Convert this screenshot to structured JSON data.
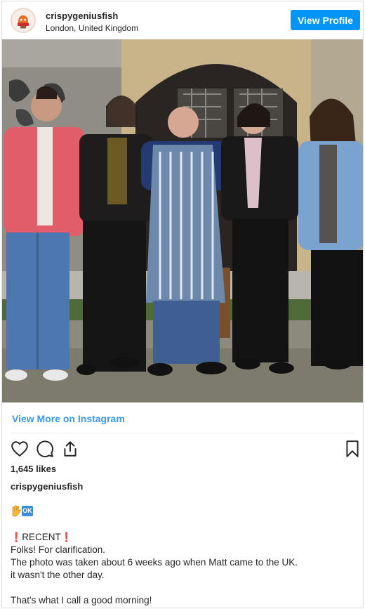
{
  "post": {
    "username": "crispygeniusfish",
    "location": "London, United Kingdom",
    "view_profile_label": "View Profile",
    "view_more_label": "View More on Instagram",
    "likes": "1,645 likes",
    "caption_username": "crispygeniusfish",
    "emoji_ok": "OK",
    "caption_lines": {
      "recent_label": "RECENT",
      "line1": "Folks! For clarification.",
      "line2": "The photo was taken about 6 weeks ago when Matt came to the UK.",
      "line3": "it wasn't the other day.",
      "line4": "That's what I call a good morning!"
    }
  },
  "icons": {
    "avatar": "avatar-logo-icon",
    "like": "heart-icon",
    "comment": "comment-icon",
    "share": "share-icon",
    "save": "bookmark-icon",
    "hand": "hand-emoji-icon",
    "exclamation": "red-exclamation-icon"
  },
  "colors": {
    "accent": "#0095f6",
    "link": "#3897f0",
    "text": "#262626",
    "border": "#dbdbdb",
    "exclamation": "#d6271e"
  }
}
